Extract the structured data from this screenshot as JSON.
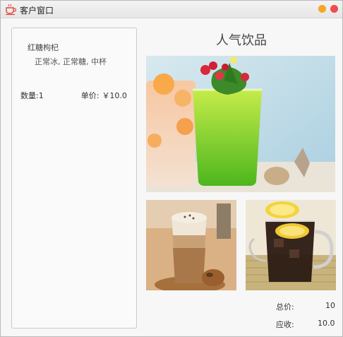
{
  "window": {
    "title": "客户窗口"
  },
  "order": {
    "item_name": "红糖枸杞",
    "item_options": "正常冰, 正常糖, 中杯",
    "quantity_label": "数量:",
    "quantity": "1",
    "unit_price_label": "单价:",
    "unit_price": "￥10.0"
  },
  "menu": {
    "title": "人气饮品",
    "images": [
      "lime-soda-photo",
      "latte-photo",
      "iced-cola-lemon-photo"
    ]
  },
  "summary": {
    "total_label": "总价:",
    "total_value": "10",
    "due_label": "应收:",
    "due_value": "10.0"
  },
  "colors": {
    "minimize": "#f5a623",
    "close": "#f04b4b"
  }
}
